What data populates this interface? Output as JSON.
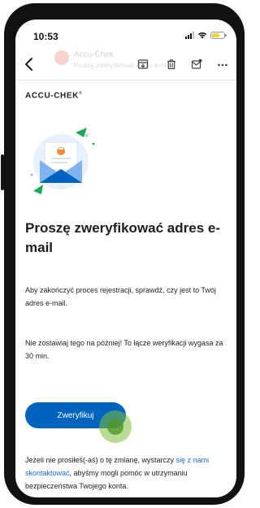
{
  "status_bar": {
    "time": "10:53"
  },
  "mail_header": {
    "sender_ghost": "Accu-Chek",
    "subject_ghost": "Proszę zweryfikować adres e-mail"
  },
  "toolbar": {
    "icons": [
      "back-chevron-icon",
      "archive-icon",
      "trash-icon",
      "mark-unread-icon",
      "more-icon"
    ]
  },
  "email": {
    "brand": "ACCU-CHEK",
    "trademark": "®",
    "heading": "Proszę zweryfikować adres e-mail",
    "intro": "Aby zakończyć proces rejestracji, sprawdź, czy jest to Twój adres e-mail.",
    "expiry_note": "Nie zostawiaj tego na później! To łącze weryfikacji wygasa za 30 min.",
    "verify_button": "Zweryfikuj",
    "footer_before": "Jeżeli nie prosiłeś(-aś) o tę zmianę, wystarczy ",
    "footer_link": "się z nami skontaktować",
    "footer_after": ", abyśmy mogli pomóc w utrzymaniu bezpieczeństwa Twojego konta."
  },
  "colors": {
    "primary_blue": "#0063be",
    "link_blue": "#1a6fcf",
    "accent_green": "#1fa855",
    "envelope_light": "#7fb4f0"
  }
}
